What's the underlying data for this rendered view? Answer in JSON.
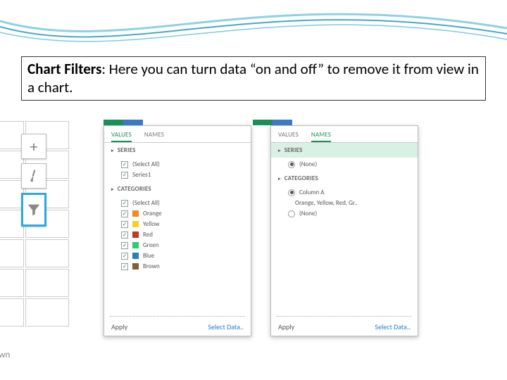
{
  "description": {
    "bold_prefix": "Chart Filters",
    "text": ": Here you can turn data “on and off” to remove it from view in a chart."
  },
  "left": {
    "row_label": "Brown"
  },
  "sq_buttons": {
    "plus": "plus-icon",
    "brush": "paintbrush-icon",
    "funnel": "funnel-icon"
  },
  "panel1": {
    "tabs": {
      "values": "VALUES",
      "names": "NAMES"
    },
    "section_series": "SERIES",
    "section_categories": "CATEGORIES",
    "series_items": [
      {
        "label": "(Select All)"
      },
      {
        "label": "Series1"
      }
    ],
    "category_items": [
      {
        "label": "(Select All)",
        "sw": null
      },
      {
        "label": "Orange",
        "sw": "#f28c1c"
      },
      {
        "label": "Yellow",
        "sw": "#efd328"
      },
      {
        "label": "Red",
        "sw": "#c0392b"
      },
      {
        "label": "Green",
        "sw": "#2ecc71"
      },
      {
        "label": "Blue",
        "sw": "#2980b9"
      },
      {
        "label": "Brown",
        "sw": "#8c5a2e"
      }
    ],
    "apply": "Apply",
    "select_data": "Select Data.."
  },
  "panel2": {
    "tabs": {
      "values": "VALUES",
      "names": "NAMES"
    },
    "section_series": "SERIES",
    "section_categories": "CATEGORIES",
    "series_items": [
      {
        "label": "(None)",
        "selected": true
      }
    ],
    "category_items": [
      {
        "label": "Column A",
        "selected": true
      },
      {
        "label_secondary": "Orange, Yellow, Red, Gr.."
      },
      {
        "label": "(None)",
        "selected": false
      }
    ],
    "apply": "Apply",
    "select_data": "Select Data.."
  },
  "colors": {
    "wave1": "#8cd1e6",
    "wave2": "#4aa7c8",
    "accent": "#1a8f5a"
  }
}
